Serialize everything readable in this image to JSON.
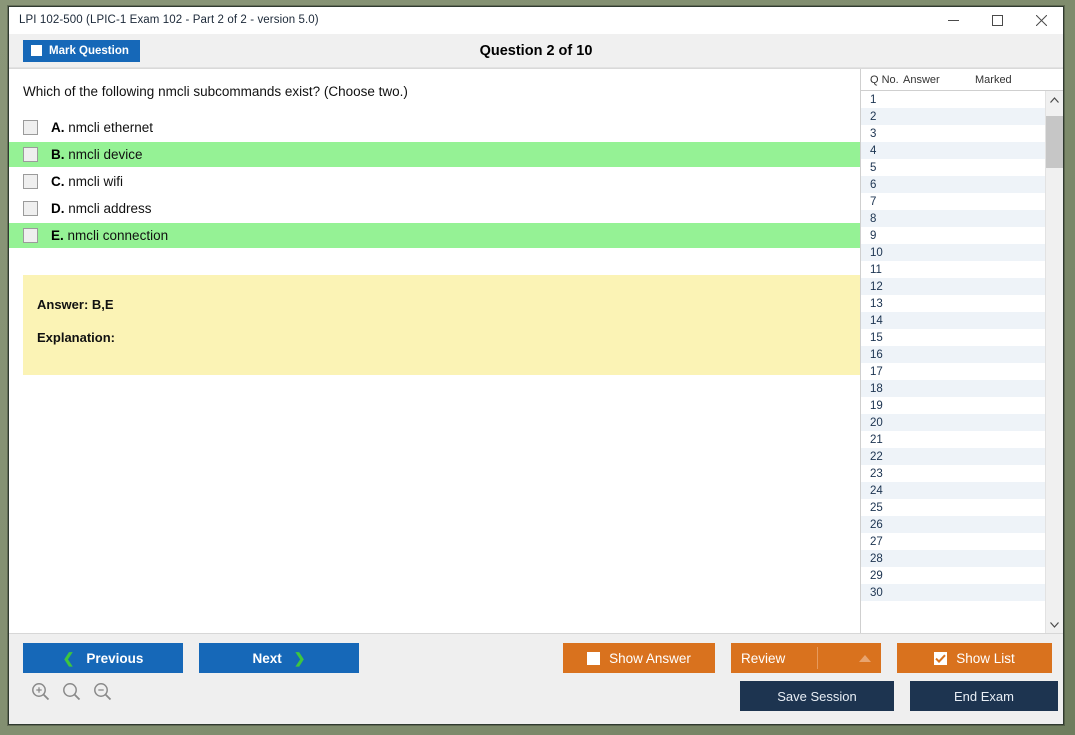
{
  "window": {
    "title": "LPI 102-500 (LPIC-1 Exam 102 - Part 2 of 2 - version 5.0)",
    "controls": {
      "minimize": "minimize-icon",
      "maximize": "maximize-icon",
      "close": "close-icon"
    }
  },
  "toolbar": {
    "mark_label": "Mark Question",
    "mark_checked": false,
    "question_title": "Question 2 of 10"
  },
  "question": {
    "text": "Which of the following nmcli subcommands exist? (Choose two.)",
    "options": [
      {
        "letter": "A.",
        "text": "nmcli ethernet",
        "highlight": false,
        "checked": false
      },
      {
        "letter": "B.",
        "text": "nmcli device",
        "highlight": true,
        "checked": false
      },
      {
        "letter": "C.",
        "text": "nmcli wifi",
        "highlight": false,
        "checked": false
      },
      {
        "letter": "D.",
        "text": "nmcli address",
        "highlight": false,
        "checked": false
      },
      {
        "letter": "E.",
        "text": "nmcli connection",
        "highlight": true,
        "checked": false
      }
    ],
    "answer_line": "Answer: B,E",
    "explanation_line": "Explanation:"
  },
  "list_panel": {
    "headers": [
      "Q No.",
      "Answer",
      "Marked"
    ],
    "rows": [
      {
        "no": "1",
        "answer": "",
        "marked": ""
      },
      {
        "no": "2",
        "answer": "",
        "marked": ""
      },
      {
        "no": "3",
        "answer": "",
        "marked": ""
      },
      {
        "no": "4",
        "answer": "",
        "marked": ""
      },
      {
        "no": "5",
        "answer": "",
        "marked": ""
      },
      {
        "no": "6",
        "answer": "",
        "marked": ""
      },
      {
        "no": "7",
        "answer": "",
        "marked": ""
      },
      {
        "no": "8",
        "answer": "",
        "marked": ""
      },
      {
        "no": "9",
        "answer": "",
        "marked": ""
      },
      {
        "no": "10",
        "answer": "",
        "marked": ""
      },
      {
        "no": "11",
        "answer": "",
        "marked": ""
      },
      {
        "no": "12",
        "answer": "",
        "marked": ""
      },
      {
        "no": "13",
        "answer": "",
        "marked": ""
      },
      {
        "no": "14",
        "answer": "",
        "marked": ""
      },
      {
        "no": "15",
        "answer": "",
        "marked": ""
      },
      {
        "no": "16",
        "answer": "",
        "marked": ""
      },
      {
        "no": "17",
        "answer": "",
        "marked": ""
      },
      {
        "no": "18",
        "answer": "",
        "marked": ""
      },
      {
        "no": "19",
        "answer": "",
        "marked": ""
      },
      {
        "no": "20",
        "answer": "",
        "marked": ""
      },
      {
        "no": "21",
        "answer": "",
        "marked": ""
      },
      {
        "no": "22",
        "answer": "",
        "marked": ""
      },
      {
        "no": "23",
        "answer": "",
        "marked": ""
      },
      {
        "no": "24",
        "answer": "",
        "marked": ""
      },
      {
        "no": "25",
        "answer": "",
        "marked": ""
      },
      {
        "no": "26",
        "answer": "",
        "marked": ""
      },
      {
        "no": "27",
        "answer": "",
        "marked": ""
      },
      {
        "no": "28",
        "answer": "",
        "marked": ""
      },
      {
        "no": "29",
        "answer": "",
        "marked": ""
      },
      {
        "no": "30",
        "answer": "",
        "marked": ""
      }
    ]
  },
  "footer": {
    "previous_label": "Previous",
    "next_label": "Next",
    "show_answer_label": "Show Answer",
    "show_answer_checked": false,
    "review_label": "Review",
    "show_list_label": "Show List",
    "show_list_checked": true,
    "save_session_label": "Save Session",
    "end_exam_label": "End Exam",
    "zoom_icons": [
      "zoom-in-icon",
      "zoom-reset-icon",
      "zoom-out-icon"
    ]
  },
  "colors": {
    "primary_blue": "#1668b8",
    "accent_orange": "#d9721e",
    "dark_navy": "#1d3450",
    "highlight_green": "#95f295",
    "answer_yellow": "#fbf3b5",
    "chevron_green": "#3ec63e"
  }
}
